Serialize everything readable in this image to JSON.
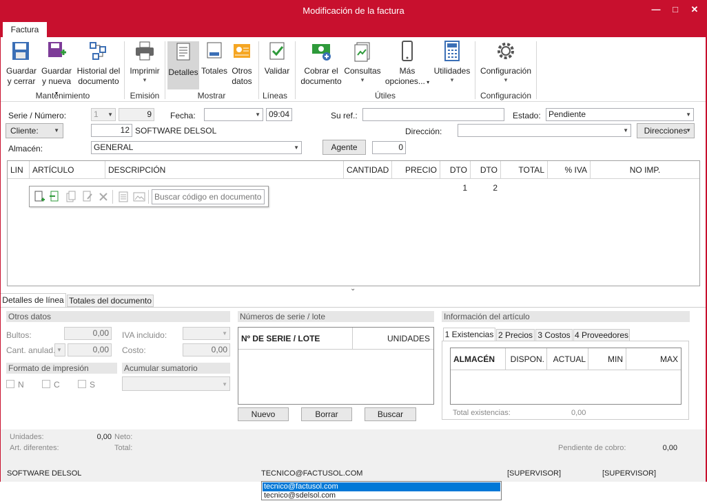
{
  "window": {
    "title": "Modificación de la factura",
    "minimize": "—",
    "maximize": "□",
    "close": "✕"
  },
  "ribbon_tab": "Factura",
  "ribbon": {
    "guardar_cerrar": [
      "Guardar",
      "y cerrar"
    ],
    "guardar_nueva": [
      "Guardar",
      "y nueva"
    ],
    "historial": [
      "Historial del",
      "documento"
    ],
    "imprimir": [
      "Imprimir",
      ""
    ],
    "detalles": [
      "Detalles"
    ],
    "totales": [
      "Totales"
    ],
    "otros_datos": [
      "Otros",
      "datos"
    ],
    "validar": [
      "Validar"
    ],
    "cobrar": [
      "Cobrar el",
      "documento"
    ],
    "consultas": [
      "Consultas",
      ""
    ],
    "mas_opciones": [
      "Más",
      "opciones..."
    ],
    "utilidades": [
      "Utilidades",
      ""
    ],
    "configuracion": [
      "Configuración",
      ""
    ],
    "groups": {
      "mantenimiento": "Mantenimiento",
      "emision": "Emisión",
      "mostrar": "Mostrar",
      "lineas": "Líneas",
      "utiles": "Útiles",
      "configuracion": "Configuración"
    }
  },
  "header": {
    "serie_label": "Serie / Número:",
    "serie": "1",
    "numero": "9",
    "fecha_label": "Fecha:",
    "fecha": "",
    "hora": "09:04",
    "suref_label": "Su ref.:",
    "suref": "",
    "estado_label": "Estado:",
    "estado": "Pendiente",
    "cliente_button": "Cliente:",
    "cliente_code": "12",
    "cliente_name": "SOFTWARE DELSOL",
    "direccion_label": "Dirección:",
    "direccion": "",
    "direcciones_button": "Direcciones",
    "almacen_label": "Almacén:",
    "almacen": "GENERAL",
    "agente_button": "Agente",
    "agente": "0"
  },
  "grid": {
    "columns": [
      "LIN",
      "ARTÍCULO",
      "DESCRIPCIÓN",
      "CANTIDAD",
      "PRECIO",
      "DTO 1",
      "DTO 2",
      "TOTAL",
      "% IVA",
      "NO IMP."
    ],
    "search_placeholder": "Buscar código en documento"
  },
  "bottom_tabs": [
    "Detalles de línea",
    "Totales del documento"
  ],
  "otros_datos": {
    "title": "Otros datos",
    "bultos_label": "Bultos:",
    "bultos": "0,00",
    "cant_label": "Cant. anulad.:",
    "cant": "0,00",
    "iva_label": "IVA incluido:",
    "costo_label": "Costo:",
    "costo": "0,00"
  },
  "formato": {
    "title": "Formato de impresión",
    "options": [
      "N",
      "C",
      "S"
    ]
  },
  "acumular": {
    "title": "Acumular sumatorio"
  },
  "series": {
    "title": "Números de serie / lote",
    "col1": "Nº DE SERIE / LOTE",
    "col2": "UNIDADES",
    "nuevo": "Nuevo",
    "borrar": "Borrar",
    "buscar": "Buscar"
  },
  "articulo": {
    "title": "Información del artículo",
    "tabs": [
      "1 Existencias",
      "2 Precios",
      "3 Costos",
      "4 Proveedores"
    ],
    "columns": [
      "ALMACÉN",
      "DISPON.",
      "ACTUAL",
      "MIN",
      "MAX"
    ],
    "total_label": "Total existencias:",
    "total": "0,00"
  },
  "footer": {
    "unidades_label": "Unidades:",
    "unidades": "0,00",
    "neto_label": "Neto:",
    "art_label": "Art. diferentes:",
    "total_label": "Total:",
    "pendiente_label": "Pendiente de cobro:",
    "pendiente": "0,00"
  },
  "status": {
    "company": "SOFTWARE DELSOL",
    "email": "TECNICO@FACTUSOL.COM",
    "user1": "[SUPERVISOR]",
    "user2": "[SUPERVISOR]"
  },
  "email_dropdown": [
    "tecnico@factusol.com",
    "tecnico@sdelsol.com"
  ]
}
